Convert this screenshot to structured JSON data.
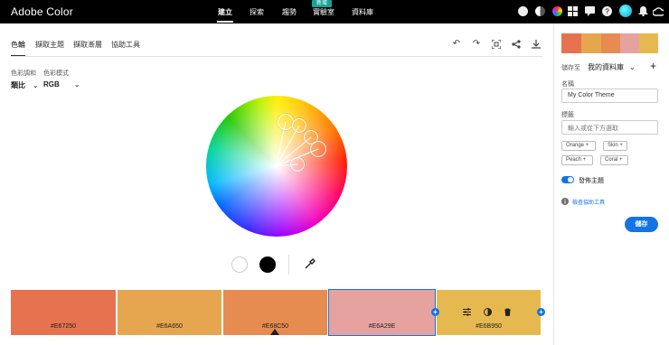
{
  "app": {
    "title": "Adobe Color"
  },
  "topnav": {
    "items": [
      {
        "label": "建立",
        "active": true
      },
      {
        "label": "探索"
      },
      {
        "label": "趨勢"
      },
      {
        "label": "實驗室",
        "badge": "新增"
      },
      {
        "label": "資料庫"
      }
    ]
  },
  "tabs": [
    "色輪",
    "擷取主題",
    "擷取漸層",
    "協助工具"
  ],
  "controls": {
    "harmony_label": "色彩調和",
    "harmony_value": "類比",
    "mode_label": "色彩模式",
    "mode_value": "RGB"
  },
  "swatches": [
    {
      "hex": "#E67250"
    },
    {
      "hex": "#E6A650"
    },
    {
      "hex": "#E68C50"
    },
    {
      "hex": "#E6A29E"
    },
    {
      "hex": "#E6B950"
    }
  ],
  "panel": {
    "save_to_label": "儲存至",
    "library": "我的資料庫",
    "name_label": "名稱",
    "name_value": "My Color Theme",
    "tags_label": "標籤",
    "tags_placeholder": "輸入或從下方選取",
    "tags": [
      "Orange",
      "Skin",
      "Peach",
      "Coral"
    ],
    "publish_label": "發佈主題",
    "a11y_link": "檢查協助工具",
    "save_button": "儲存"
  }
}
